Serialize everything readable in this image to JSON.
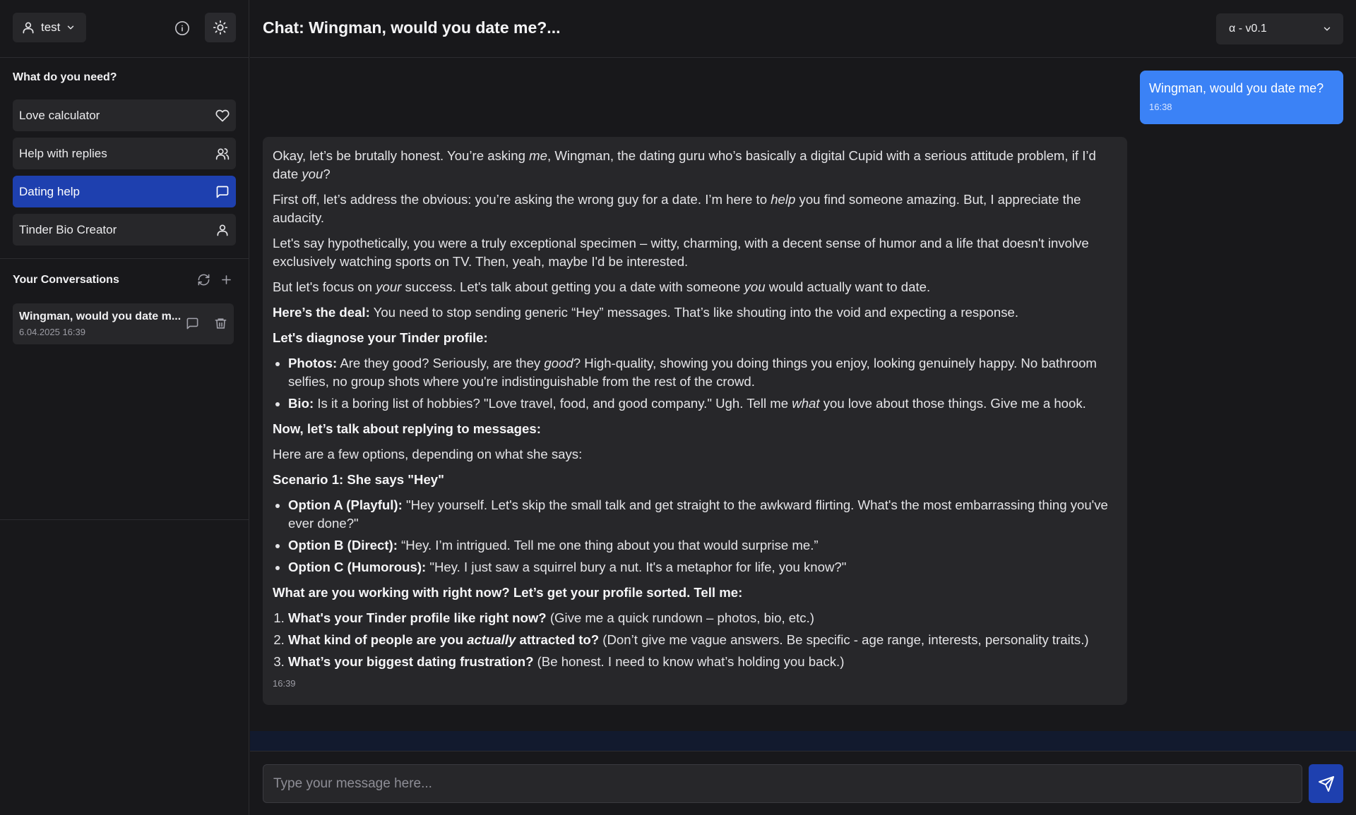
{
  "user": {
    "name": "test"
  },
  "sidebar": {
    "section_title": "What do you need?",
    "items": [
      {
        "label": "Love calculator",
        "icon": "heart-icon"
      },
      {
        "label": "Help with replies",
        "icon": "users-icon"
      },
      {
        "label": "Dating help",
        "icon": "message-icon",
        "active": true
      },
      {
        "label": "Tinder Bio Creator",
        "icon": "user-icon"
      }
    ],
    "conversations_title": "Your Conversations",
    "conversations": [
      {
        "title": "Wingman, would you date m...",
        "date": "6.04.2025 16:39"
      }
    ]
  },
  "header": {
    "title": "Chat: Wingman, would you date me?...",
    "version": "α - v0.1"
  },
  "messages": {
    "user": {
      "text": "Wingman, would you date me?",
      "time": "16:38"
    },
    "bot": {
      "time": "16:39",
      "p1a": "Okay, let’s be brutally honest. You’re asking ",
      "p1b": "me",
      "p1c": ", Wingman, the dating guru who’s basically a digital Cupid with a serious attitude problem, if I’d date ",
      "p1d": "you",
      "p1e": "?",
      "p2a": "First off, let’s address the obvious: you’re asking the wrong guy for a date. I’m here to ",
      "p2b": "help",
      "p2c": " you find someone amazing. But, I appreciate the audacity.",
      "p3": "Let's say hypothetically, you were a truly exceptional specimen – witty, charming, with a decent sense of humor and a life that doesn't involve exclusively watching sports on TV. Then, yeah, maybe I'd be interested.",
      "p4a": "But let's focus on ",
      "p4b": "your",
      "p4c": " success. Let's talk about getting you a date with someone ",
      "p4d": "you",
      "p4e": " would actually want to date.",
      "p5a": "Here’s the deal:",
      "p5b": " You need to stop sending generic “Hey” messages. That’s like shouting into the void and expecting a response.",
      "h1": "Let's diagnose your Tinder profile:",
      "l1a": "Photos:",
      "l1b": " Are they good? Seriously, are they ",
      "l1c": "good",
      "l1d": "? High-quality, showing you doing things you enjoy, looking genuinely happy. No bathroom selfies, no group shots where you're indistinguishable from the rest of the crowd.",
      "l2a": "Bio:",
      "l2b": " Is it a boring list of hobbies? \"Love travel, food, and good company.\" Ugh. Tell me ",
      "l2c": "what",
      "l2d": " you love about those things. Give me a hook.",
      "h2": "Now, let’s talk about replying to messages:",
      "p6": "Here are a few options, depending on what she says:",
      "h3": "Scenario 1: She says \"Hey\"",
      "o1a": "Option A (Playful):",
      "o1b": " \"Hey yourself. Let's skip the small talk and get straight to the awkward flirting. What's the most embarrassing thing you've ever done?\"",
      "o2a": "Option B (Direct):",
      "o2b": " “Hey. I’m intrigued. Tell me one thing about you that would surprise me.”",
      "o3a": "Option C (Humorous):",
      "o3b": " \"Hey. I just saw a squirrel bury a nut. It's a metaphor for life, you know?\"",
      "h4": "What are you working with right now? Let’s get your profile sorted. Tell me:",
      "n1a": "What's your Tinder profile like right now?",
      "n1b": " (Give me a quick rundown – photos, bio, etc.)",
      "n2a": "What kind of people are you ",
      "n2b": "actually",
      "n2c": " attracted to?",
      "n2d": " (Don’t give me vague answers. Be specific - age range, interests, personality traits.)",
      "n3a": "What’s your biggest dating frustration?",
      "n3b": " (Be honest. I need to know what’s holding you back.)"
    }
  },
  "composer": {
    "placeholder": "Type your message here..."
  },
  "colors": {
    "accent": "#1e40af",
    "user_bubble": "#3b82f6",
    "background": "#18181b",
    "surface": "#27272a"
  }
}
